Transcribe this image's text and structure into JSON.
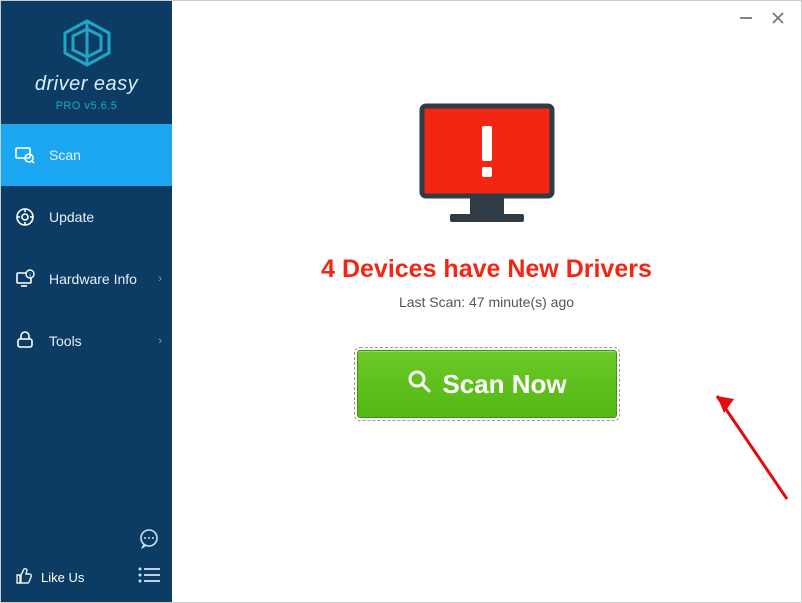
{
  "brand": {
    "name": "driver easy",
    "version": "PRO v5.6.5"
  },
  "sidebar": {
    "items": [
      {
        "label": "Scan",
        "icon": "scan-icon",
        "active": true,
        "chevron": false
      },
      {
        "label": "Update",
        "icon": "update-icon",
        "active": false,
        "chevron": false
      },
      {
        "label": "Hardware Info",
        "icon": "hardware-icon",
        "active": false,
        "chevron": true
      },
      {
        "label": "Tools",
        "icon": "tools-icon",
        "active": false,
        "chevron": true
      }
    ],
    "like_label": "Like Us"
  },
  "main": {
    "alert_title": "4 Devices have New Drivers",
    "last_scan": "Last Scan: 47 minute(s) ago",
    "scan_button": "Scan Now"
  },
  "colors": {
    "accent": "#1ba7f1",
    "sidebar": "#0c3b64",
    "danger": "#f22613",
    "action": "#5cbf1a"
  }
}
